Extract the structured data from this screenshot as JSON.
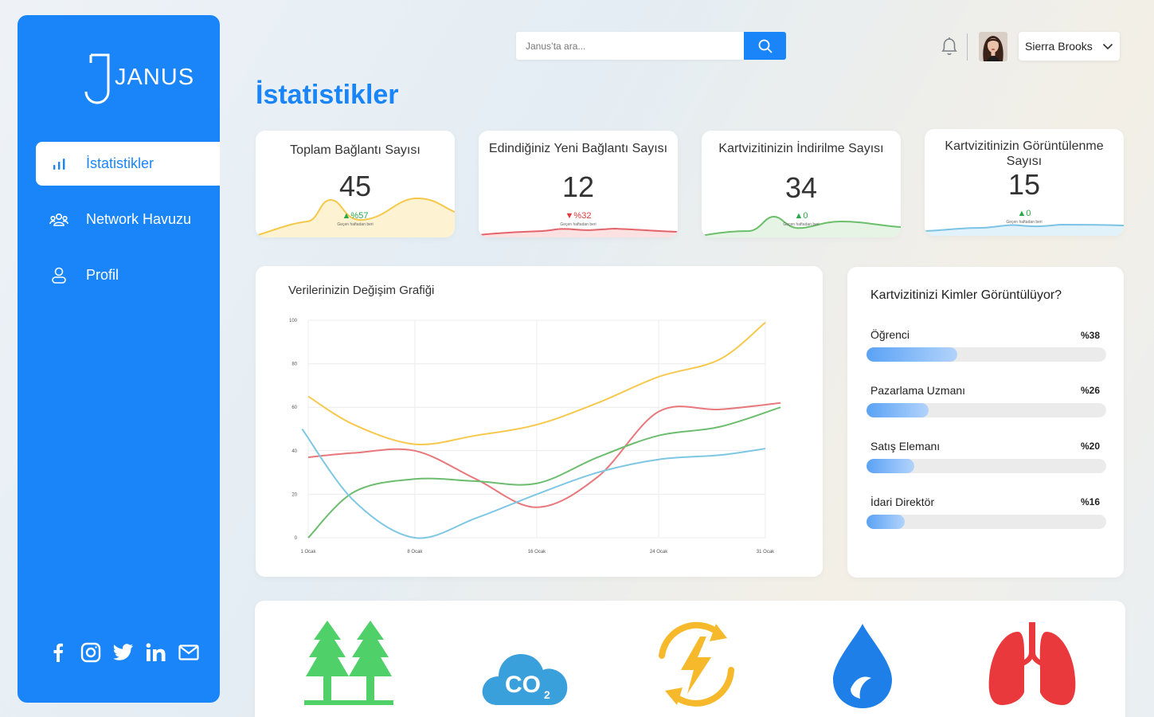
{
  "app": {
    "logo_text": "JANUS"
  },
  "sidebar": {
    "items": [
      {
        "label": "İstatistikler",
        "icon": "bar-chart-icon",
        "active": true
      },
      {
        "label": "Network Havuzu",
        "icon": "group-icon",
        "active": false
      },
      {
        "label": "Profil",
        "icon": "user-icon",
        "active": false
      }
    ],
    "socials": [
      "facebook-icon",
      "instagram-icon",
      "twitter-icon",
      "linkedin-icon",
      "mail-icon"
    ]
  },
  "header": {
    "search_placeholder": "Janus’ta ara...",
    "user_name": "Sierra Brooks"
  },
  "page": {
    "title": "İstatistikler"
  },
  "stats": [
    {
      "title": "Toplam Bağlantı Sayısı",
      "value": "45",
      "change": "%57",
      "direction": "up",
      "sub": "Geçen haftadan beri",
      "color": "#f5c84a"
    },
    {
      "title": "Edindiğiniz Yeni Bağlantı Sayısı",
      "value": "12",
      "change": "%32",
      "direction": "down",
      "sub": "Geçen haftadan beri",
      "color": "#e3646a"
    },
    {
      "title": "Kartvizitinizin İndirilme Sayısı",
      "value": "34",
      "change": "0",
      "direction": "up",
      "sub": "Geçen haftadan beri",
      "color": "#6cbf6a"
    },
    {
      "title": "Kartvizitinizin Görüntülenme Sayısı",
      "value": "15",
      "change": "0",
      "direction": "up",
      "sub": "Geçen haftadan beri",
      "color": "#7cc3e6"
    }
  ],
  "chart_data": {
    "type": "line",
    "title": "Verilerinizin Değişim Grafiği",
    "xlabel": "",
    "ylabel": "",
    "categories": [
      "1 Ocak",
      "8 Ocak",
      "16 Ocak",
      "24 Ocak",
      "31 Ocak"
    ],
    "ylim": [
      0,
      100
    ],
    "yticks": [
      0,
      20,
      40,
      60,
      80,
      100
    ],
    "grid": true,
    "series": [
      {
        "color": "#f6c94e",
        "x": [
          1,
          4,
          8,
          12,
          16,
          20,
          24,
          28,
          31
        ],
        "values": [
          65,
          52,
          43,
          47,
          52,
          62,
          74,
          82,
          99
        ]
      },
      {
        "color": "#e8787c",
        "x": [
          1,
          4,
          8,
          12,
          16,
          20,
          24,
          28,
          32
        ],
        "values": [
          37,
          39,
          40,
          27,
          14,
          28,
          58,
          59,
          62
        ]
      },
      {
        "color": "#6dbd6f",
        "x": [
          1,
          4,
          8,
          12,
          16,
          20,
          24,
          28,
          32
        ],
        "values": [
          0,
          21,
          27,
          26,
          25,
          37,
          47,
          51,
          60
        ]
      },
      {
        "color": "#7ec7e4",
        "x": [
          0.6,
          4,
          8,
          12,
          16,
          20,
          24,
          28,
          31
        ],
        "values": [
          50,
          17,
          0,
          9,
          20,
          30,
          36,
          38,
          41
        ]
      }
    ]
  },
  "viewers": {
    "title": "Kartvizitinizi Kimler Görüntülüyor?",
    "rows": [
      {
        "label": "Öğrenci",
        "percent_text": "%38",
        "fraction": 0.38
      },
      {
        "label": "Pazarlama Uzmanı",
        "percent_text": "%26",
        "fraction": 0.26
      },
      {
        "label": "Satış Elemanı",
        "percent_text": "%20",
        "fraction": 0.2
      },
      {
        "label": "İdari Direktör",
        "percent_text": "%16",
        "fraction": 0.16
      }
    ]
  },
  "impact": {
    "icons": [
      "trees-icon",
      "co2-cloud-icon",
      "renewable-energy-icon",
      "water-drop-icon",
      "lungs-icon"
    ],
    "co2_text": "CO",
    "co2_sub": "2"
  },
  "colors": {
    "brand": "#1a85f9",
    "up": "#2aa84a",
    "down": "#e03a3a"
  }
}
